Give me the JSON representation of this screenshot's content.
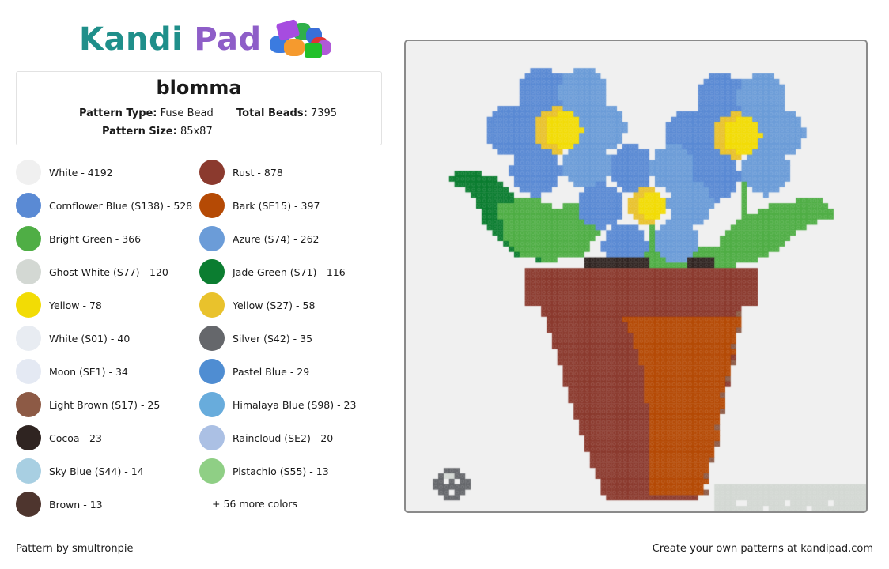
{
  "brand": {
    "name_part1": "Kandi",
    "name_part2": "Pad",
    "colors": {
      "kandi": "#1f8f8a",
      "pad": "#8e5ec8"
    }
  },
  "pattern": {
    "title": "blomma",
    "type_label": "Pattern Type:",
    "type_value": "Fuse Bead",
    "beads_label": "Total Beads:",
    "beads_value": "7395",
    "size_label": "Pattern Size:",
    "size_value": "85x87",
    "grid": {
      "cols": 85,
      "rows": 87
    }
  },
  "legend": {
    "items": [
      {
        "label": "White - 4192",
        "color": "#f0f0f0"
      },
      {
        "label": "Rust - 878",
        "color": "#8b3a2e"
      },
      {
        "label": "Cornflower Blue (S138) - 528",
        "color": "#5a8ad4"
      },
      {
        "label": "Bark (SE15) - 397",
        "color": "#b54a05"
      },
      {
        "label": "Bright Green - 366",
        "color": "#4fae45"
      },
      {
        "label": "Azure (S74) - 262",
        "color": "#6b9cd8"
      },
      {
        "label": "Ghost White (S77) - 120",
        "color": "#d3d8d3"
      },
      {
        "label": "Jade Green (S71) - 116",
        "color": "#0b7d30"
      },
      {
        "label": "Yellow - 78",
        "color": "#f2dc05"
      },
      {
        "label": "Yellow (S27) - 58",
        "color": "#e9c22c"
      },
      {
        "label": "White (S01) - 40",
        "color": "#e8ecf2"
      },
      {
        "label": "Silver (S42) - 35",
        "color": "#65676b"
      },
      {
        "label": "Moon (SE1) - 34",
        "color": "#e4e9f3"
      },
      {
        "label": "Pastel Blue - 29",
        "color": "#4f8dd2"
      },
      {
        "label": "Light Brown (S17) - 25",
        "color": "#8d5a45"
      },
      {
        "label": "Himalaya Blue (S98) - 23",
        "color": "#68acdc"
      },
      {
        "label": "Cocoa - 23",
        "color": "#2f2421"
      },
      {
        "label": "Raincloud (SE2) - 20",
        "color": "#abc0e4"
      },
      {
        "label": "Sky Blue (S44) - 14",
        "color": "#a8cfe2"
      },
      {
        "label": "Pistachio (S55) - 13",
        "color": "#8fcf85"
      },
      {
        "label": "Brown - 13",
        "color": "#4e352e"
      }
    ],
    "more_label": "+ 56 more colors"
  },
  "footer": {
    "credit": "Pattern by smultronpie",
    "cta": "Create your own patterns at kandipad.com"
  }
}
